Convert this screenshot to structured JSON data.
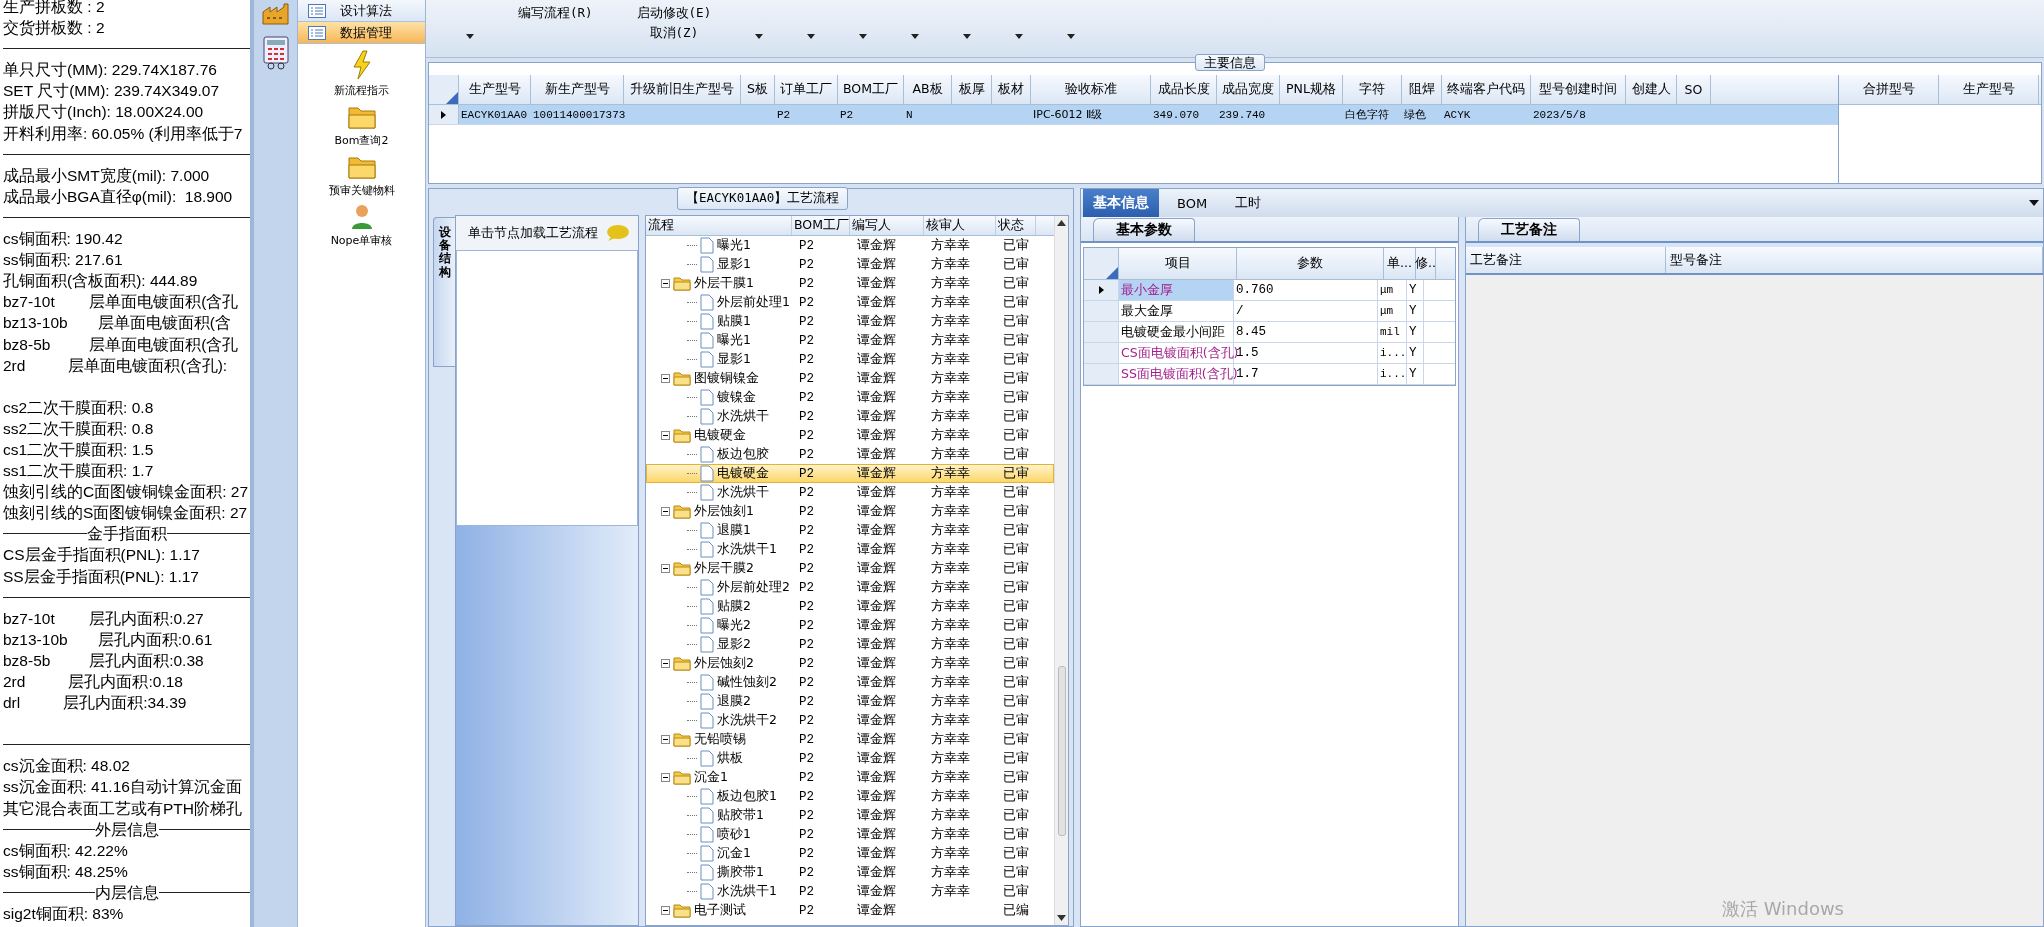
{
  "stats": {
    "lines": [
      {
        "kind": "text",
        "text": "生产拼板数 : 2"
      },
      {
        "kind": "text",
        "text": "交货拼板数 : 2"
      },
      {
        "kind": "rule"
      },
      {
        "kind": "text",
        "text": "单只尺寸(MM): 229.74X187.76"
      },
      {
        "kind": "text",
        "text": "SET 尺寸(MM): 239.74X349.07"
      },
      {
        "kind": "text",
        "text": "拼版尺寸(Inch): 18.00X24.00"
      },
      {
        "kind": "text",
        "text": "开料利用率: 60.05% (利用率低于7"
      },
      {
        "kind": "rule"
      },
      {
        "kind": "text",
        "text": "成品最小SMT宽度(mil): 7.000"
      },
      {
        "kind": "text",
        "text": "成品最小BGA直径φ(mil):  18.900"
      },
      {
        "kind": "rule"
      },
      {
        "kind": "text",
        "text": "cs铜面积: 190.42"
      },
      {
        "kind": "text",
        "text": "ss铜面积: 217.61"
      },
      {
        "kind": "text",
        "text": "孔铜面积(含板面积): 444.89"
      },
      {
        "kind": "text",
        "text": "bz7-10t        层单面电镀面积(含孔"
      },
      {
        "kind": "text",
        "text": "bz13-10b       层单面电镀面积(含"
      },
      {
        "kind": "text",
        "text": "bz8-5b         层单面电镀面积(含孔"
      },
      {
        "kind": "text",
        "text": "2rd          层单面电镀面积(含孔):"
      },
      {
        "kind": "blank"
      },
      {
        "kind": "text",
        "text": "cs2二次干膜面积: 0.8"
      },
      {
        "kind": "text",
        "text": "ss2二次干膜面积: 0.8"
      },
      {
        "kind": "text",
        "text": "cs1二次干膜面积: 1.5"
      },
      {
        "kind": "text",
        "text": "ss1二次干膜面积: 1.7"
      },
      {
        "kind": "text",
        "text": "蚀刻引线的C面图镀铜镍金面积: 27"
      },
      {
        "kind": "text",
        "text": "蚀刻引线的S面图镀铜镍金面积: 27"
      },
      {
        "kind": "heading",
        "text": "金手指面积"
      },
      {
        "kind": "text",
        "text": "CS层金手指面积(PNL): 1.17"
      },
      {
        "kind": "text",
        "text": "SS层金手指面积(PNL): 1.17"
      },
      {
        "kind": "rule"
      },
      {
        "kind": "text",
        "text": "bz7-10t        层孔内面积:0.27"
      },
      {
        "kind": "text",
        "text": "bz13-10b       层孔内面积:0.61"
      },
      {
        "kind": "text",
        "text": "bz8-5b         层孔内面积:0.38"
      },
      {
        "kind": "text",
        "text": "2rd          层孔内面积:0.18"
      },
      {
        "kind": "text",
        "text": "drl          层孔内面积:34.39"
      },
      {
        "kind": "blank"
      },
      {
        "kind": "rule"
      },
      {
        "kind": "text",
        "text": "cs沉金面积: 48.02"
      },
      {
        "kind": "text",
        "text": "ss沉金面积: 41.16自动计算沉金面"
      },
      {
        "kind": "text",
        "text": "其它混合表面工艺或有PTH阶梯孔"
      },
      {
        "kind": "heading",
        "text": "外层信息"
      },
      {
        "kind": "text",
        "text": "cs铜面积: 42.22%"
      },
      {
        "kind": "text",
        "text": "ss铜面积: 48.25%"
      },
      {
        "kind": "heading",
        "text": "内层信息"
      },
      {
        "kind": "text",
        "text": "sig2t铜面积: 83%"
      }
    ]
  },
  "nav": {
    "sections": [
      {
        "label": "设计算法",
        "selected": false
      },
      {
        "label": "数据管理",
        "selected": true
      }
    ],
    "items": [
      {
        "kind": "bolt",
        "label": "新流程指示"
      },
      {
        "kind": "folder",
        "label": "Bom查询2"
      },
      {
        "kind": "folder",
        "label": "预审关键物料"
      },
      {
        "kind": "person",
        "label": "Nope单审核"
      }
    ]
  },
  "toolbar": {
    "items": [
      {
        "kind": "caret"
      },
      {
        "kind": "command",
        "label": "编写流程(R)"
      },
      {
        "kind": "command",
        "label": "启动修改(E)",
        "sub": "取消(Z)"
      },
      {
        "kind": "caret"
      },
      {
        "kind": "caret"
      },
      {
        "kind": "caret"
      },
      {
        "kind": "caret"
      },
      {
        "kind": "caret"
      },
      {
        "kind": "caret"
      },
      {
        "kind": "caret"
      }
    ]
  },
  "main_info": {
    "title": "主要信息",
    "columns": [
      "生产型号",
      "新生产型号",
      "升级前旧生产型号",
      "S板",
      "订单工厂",
      "BOM工厂",
      "AB板",
      "板厚",
      "板材",
      "验收标准",
      "成品长度",
      "成品宽度",
      "PNL规格",
      "字符",
      "阻焊",
      "终端客户代码",
      "型号创建时间",
      "创建人",
      "SO"
    ],
    "rows": [
      {
        "selected": true,
        "cells": [
          "EACYK01AA0",
          "10011400017373",
          null,
          null,
          "P2",
          "P2",
          "N",
          null,
          null,
          "IPC-6012 Ⅱ级",
          "349.070",
          "239.740",
          null,
          "白色字符",
          "绿色",
          "ACYK",
          "2023/5/8",
          null,
          null
        ]
      }
    ],
    "merge_columns": [
      "合拼型号",
      "生产型号"
    ]
  },
  "flow": {
    "title": "【EACYK01AA0】工艺流程",
    "side_tab": "设备结构",
    "hint": "单击节点加载工艺流程",
    "columns": [
      "流程",
      "BOM工厂",
      "编写人",
      "核审人",
      "状态"
    ],
    "nodes": [
      {
        "kind": "step",
        "label": "曝光1",
        "bom": "P2",
        "writer": "谭金辉",
        "reviewer": "方幸幸",
        "status": "已审",
        "selected": false
      },
      {
        "kind": "step",
        "label": "显影1",
        "bom": "P2",
        "writer": "谭金辉",
        "reviewer": "方幸幸",
        "status": "已审",
        "selected": false
      },
      {
        "kind": "folder",
        "label": "外层干膜1",
        "bom": "P2",
        "writer": "谭金辉",
        "reviewer": "方幸幸",
        "status": "已审",
        "selected": false,
        "expanded": true,
        "children": [
          {
            "kind": "step",
            "label": "外层前处理1",
            "bom": "P2",
            "writer": "谭金辉",
            "reviewer": "方幸幸",
            "status": "已审",
            "selected": false
          },
          {
            "kind": "step",
            "label": "贴膜1",
            "bom": "P2",
            "writer": "谭金辉",
            "reviewer": "方幸幸",
            "status": "已审",
            "selected": false
          },
          {
            "kind": "step",
            "label": "曝光1",
            "bom": "P2",
            "writer": "谭金辉",
            "reviewer": "方幸幸",
            "status": "已审",
            "selected": false
          },
          {
            "kind": "step",
            "label": "显影1",
            "bom": "P2",
            "writer": "谭金辉",
            "reviewer": "方幸幸",
            "status": "已审",
            "selected": false
          }
        ]
      },
      {
        "kind": "folder",
        "label": "图镀铜镍金",
        "bom": "P2",
        "writer": "谭金辉",
        "reviewer": "方幸幸",
        "status": "已审",
        "selected": false,
        "expanded": true,
        "children": [
          {
            "kind": "step",
            "label": "镀镍金",
            "bom": "P2",
            "writer": "谭金辉",
            "reviewer": "方幸幸",
            "status": "已审",
            "selected": false
          },
          {
            "kind": "step",
            "label": "水洗烘干",
            "bom": "P2",
            "writer": "谭金辉",
            "reviewer": "方幸幸",
            "status": "已审",
            "selected": false
          }
        ]
      },
      {
        "kind": "folder",
        "label": "电镀硬金",
        "bom": "P2",
        "writer": "谭金辉",
        "reviewer": "方幸幸",
        "status": "已审",
        "selected": false,
        "expanded": true,
        "children": [
          {
            "kind": "step",
            "label": "板边包胶",
            "bom": "P2",
            "writer": "谭金辉",
            "reviewer": "方幸幸",
            "status": "已审",
            "selected": false
          },
          {
            "kind": "step",
            "label": "电镀硬金",
            "bom": "P2",
            "writer": "谭金辉",
            "reviewer": "方幸幸",
            "status": "已审",
            "selected": true
          },
          {
            "kind": "step",
            "label": "水洗烘干",
            "bom": "P2",
            "writer": "谭金辉",
            "reviewer": "方幸幸",
            "status": "已审",
            "selected": false
          }
        ]
      },
      {
        "kind": "folder",
        "label": "外层蚀刻1",
        "bom": "P2",
        "writer": "谭金辉",
        "reviewer": "方幸幸",
        "status": "已审",
        "selected": false,
        "expanded": true,
        "children": [
          {
            "kind": "step",
            "label": "退膜1",
            "bom": "P2",
            "writer": "谭金辉",
            "reviewer": "方幸幸",
            "status": "已审",
            "selected": false
          },
          {
            "kind": "step",
            "label": "水洗烘干1",
            "bom": "P2",
            "writer": "谭金辉",
            "reviewer": "方幸幸",
            "status": "已审",
            "selected": false
          }
        ]
      },
      {
        "kind": "folder",
        "label": "外层干膜2",
        "bom": "P2",
        "writer": "谭金辉",
        "reviewer": "方幸幸",
        "status": "已审",
        "selected": false,
        "expanded": true,
        "children": [
          {
            "kind": "step",
            "label": "外层前处理2",
            "bom": "P2",
            "writer": "谭金辉",
            "reviewer": "方幸幸",
            "status": "已审",
            "selected": false
          },
          {
            "kind": "step",
            "label": "贴膜2",
            "bom": "P2",
            "writer": "谭金辉",
            "reviewer": "方幸幸",
            "status": "已审",
            "selected": false
          },
          {
            "kind": "step",
            "label": "曝光2",
            "bom": "P2",
            "writer": "谭金辉",
            "reviewer": "方幸幸",
            "status": "已审",
            "selected": false
          },
          {
            "kind": "step",
            "label": "显影2",
            "bom": "P2",
            "writer": "谭金辉",
            "reviewer": "方幸幸",
            "status": "已审",
            "selected": false
          }
        ]
      },
      {
        "kind": "folder",
        "label": "外层蚀刻2",
        "bom": "P2",
        "writer": "谭金辉",
        "reviewer": "方幸幸",
        "status": "已审",
        "selected": false,
        "expanded": true,
        "children": [
          {
            "kind": "step",
            "label": "碱性蚀刻2",
            "bom": "P2",
            "writer": "谭金辉",
            "reviewer": "方幸幸",
            "status": "已审",
            "selected": false
          },
          {
            "kind": "step",
            "label": "退膜2",
            "bom": "P2",
            "writer": "谭金辉",
            "reviewer": "方幸幸",
            "status": "已审",
            "selected": false
          },
          {
            "kind": "step",
            "label": "水洗烘干2",
            "bom": "P2",
            "writer": "谭金辉",
            "reviewer": "方幸幸",
            "status": "已审",
            "selected": false
          }
        ]
      },
      {
        "kind": "folder",
        "label": "无铅喷锡",
        "bom": "P2",
        "writer": "谭金辉",
        "reviewer": "方幸幸",
        "status": "已审",
        "selected": false,
        "expanded": true,
        "children": [
          {
            "kind": "step",
            "label": "烘板",
            "bom": "P2",
            "writer": "谭金辉",
            "reviewer": "方幸幸",
            "status": "已审",
            "selected": false
          }
        ]
      },
      {
        "kind": "folder",
        "label": "沉金1",
        "bom": "P2",
        "writer": "谭金辉",
        "reviewer": "方幸幸",
        "status": "已审",
        "selected": false,
        "expanded": true,
        "children": [
          {
            "kind": "step",
            "label": "板边包胶1",
            "bom": "P2",
            "writer": "谭金辉",
            "reviewer": "方幸幸",
            "status": "已审",
            "selected": false
          },
          {
            "kind": "step",
            "label": "贴胶带1",
            "bom": "P2",
            "writer": "谭金辉",
            "reviewer": "方幸幸",
            "status": "已审",
            "selected": false
          },
          {
            "kind": "step",
            "label": "喷砂1",
            "bom": "P2",
            "writer": "谭金辉",
            "reviewer": "方幸幸",
            "status": "已审",
            "selected": false
          },
          {
            "kind": "step",
            "label": "沉金1",
            "bom": "P2",
            "writer": "谭金辉",
            "reviewer": "方幸幸",
            "status": "已审",
            "selected": false
          },
          {
            "kind": "step",
            "label": "撕胶带1",
            "bom": "P2",
            "writer": "谭金辉",
            "reviewer": "方幸幸",
            "status": "已审",
            "selected": false
          },
          {
            "kind": "step",
            "label": "水洗烘干1",
            "bom": "P2",
            "writer": "谭金辉",
            "reviewer": "方幸幸",
            "status": "已审",
            "selected": false
          }
        ]
      },
      {
        "kind": "folder",
        "label": "电子测试",
        "bom": "P2",
        "writer": "谭金辉",
        "status": "已编",
        "selected": false,
        "expanded": true
      }
    ]
  },
  "detail": {
    "tabs": [
      {
        "label": "基本信息",
        "selected": true
      },
      {
        "label": "BOM",
        "selected": false
      },
      {
        "label": "工时",
        "selected": false
      }
    ],
    "params_tab": "基本参数",
    "param_columns": [
      "项目",
      "参数",
      "单...",
      "修.."
    ],
    "params": [
      {
        "item": "最小金厚",
        "value": "0.760",
        "unit": "μm",
        "flag": "Y",
        "highlighted": true,
        "selected": true
      },
      {
        "item": "最大金厚",
        "value": "/",
        "unit": "μm",
        "flag": "Y",
        "highlighted": false,
        "selected": false
      },
      {
        "item": "电镀硬金最小间距",
        "value": "8.45",
        "unit": "mil",
        "flag": "Y",
        "highlighted": false,
        "selected": false
      },
      {
        "item": "CS面电镀面积(含孔)",
        "value": "1.5",
        "unit": "i...",
        "flag": "Y",
        "highlighted": true,
        "selected": false
      },
      {
        "item": "SS面电镀面积(含孔)",
        "value": "1.7",
        "unit": "i...",
        "flag": "Y",
        "highlighted": true,
        "selected": false
      }
    ],
    "notes_tab": "工艺备注",
    "note_columns": [
      "工艺备注",
      "型号备注"
    ]
  },
  "os_watermark": "激活 Windows"
}
